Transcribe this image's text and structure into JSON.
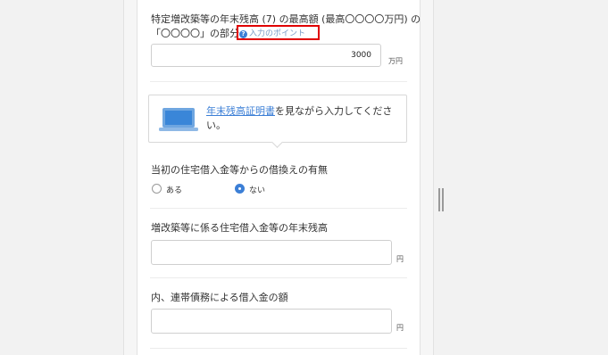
{
  "fields": {
    "max_amount": {
      "label_line1": "特定増改築等の年末残高 (7) の最高額 (最高〇〇〇〇万円) の",
      "label_line2": "「〇〇〇〇」の部分",
      "hint_label": "入力のポイント",
      "value": "3000",
      "unit": "万円"
    },
    "callout": {
      "link_text": "年末残高証明書",
      "text": "を見ながら入力してください。"
    },
    "refinance": {
      "label": "当初の住宅借入金等からの借換えの有無",
      "options": [
        {
          "label": "ある",
          "selected": false
        },
        {
          "label": "ない",
          "selected": true
        }
      ]
    },
    "year_end_balance": {
      "label": "増改築等に係る住宅借入金等の年末残高",
      "value": "",
      "unit": "円"
    },
    "joint_debt": {
      "label": "内、連帯債務による借入金の額",
      "value": "",
      "unit": "円"
    }
  },
  "colors": {
    "accent": "#3c7fd6",
    "highlight_frame": "#e00000"
  }
}
